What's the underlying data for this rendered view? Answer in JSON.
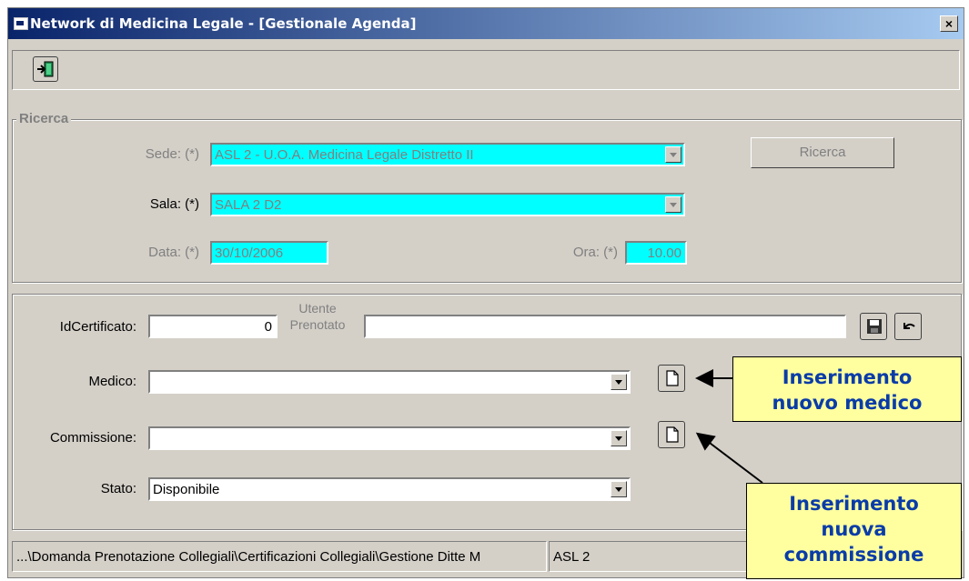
{
  "window": {
    "title": "Network di Medicina Legale - [Gestionale Agenda]",
    "close_label": "×"
  },
  "toolbar": {
    "exit_icon": "exit-door-icon"
  },
  "ricerca": {
    "legend": "Ricerca",
    "sede_label": "Sede: (*)",
    "sede_value": "ASL 2 - U.O.A. Medicina Legale Distretto II",
    "sala_label": "Sala: (*)",
    "sala_value": "SALA 2 D2",
    "data_label": "Data: (*)",
    "data_value": "30/10/2006",
    "ora_label": "Ora: (*)",
    "ora_value": "10.00",
    "search_button": "Ricerca"
  },
  "form": {
    "idcert_label": "IdCertificato:",
    "idcert_value": "0",
    "utente_label_1": "Utente",
    "utente_label_2": "Prenotato",
    "utente_value": "",
    "medico_label": "Medico:",
    "medico_value": "",
    "commissione_label": "Commissione:",
    "commissione_value": "",
    "stato_label": "Stato:",
    "stato_value": "Disponibile"
  },
  "statusbar": {
    "path": "...\\Domanda Prenotazione Collegiali\\Certificazioni Collegiali\\Gestione Ditte M",
    "asl": "ASL 2"
  },
  "callouts": {
    "medico_line1": "Inserimento",
    "medico_line2": "nuovo medico",
    "commissione_line1": "Inserimento",
    "commissione_line2": "nuova",
    "commissione_line3": "commissione"
  },
  "colors": {
    "title_bar": "#0a246a",
    "window_bg": "#d4d0c8",
    "field_highlight": "#00ffff",
    "callout_bg": "#ffffa0",
    "callout_text": "#0a3ca8"
  }
}
